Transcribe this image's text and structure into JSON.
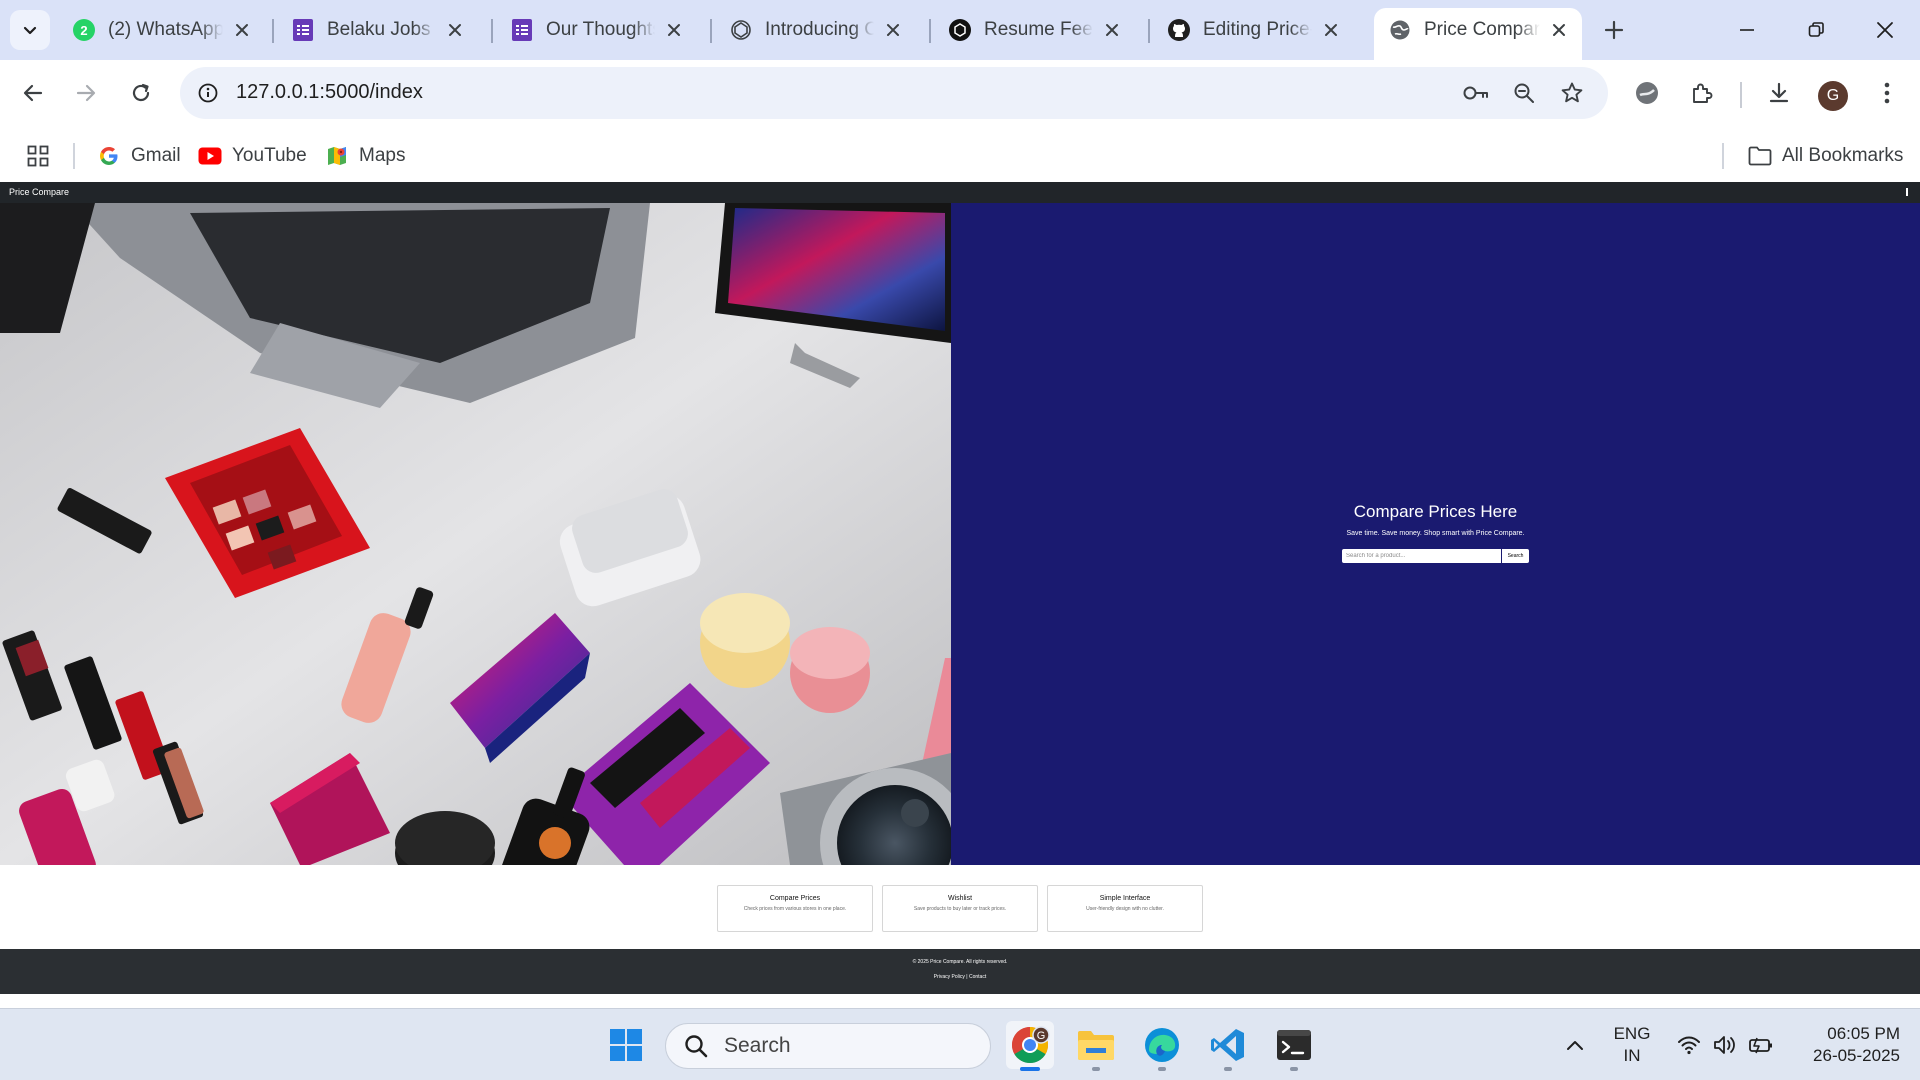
{
  "browser": {
    "tabs": [
      {
        "title": "(2) WhatsApp",
        "icon": "whatsapp-icon",
        "badge": "2",
        "active": false
      },
      {
        "title": "Belaku Jobs",
        "icon": "forms-icon",
        "active": false
      },
      {
        "title": "Our Thoughts",
        "icon": "forms-icon",
        "active": false
      },
      {
        "title": "Introducing Cl",
        "icon": "openai-icon",
        "active": false
      },
      {
        "title": "Resume Feedl",
        "icon": "openai-icon",
        "active": false
      },
      {
        "title": "Editing Price-C",
        "icon": "github-icon",
        "active": false
      },
      {
        "title": "Price Compare",
        "icon": "globe-icon",
        "active": true
      }
    ],
    "address_bar": {
      "url": "127.0.0.1:5000/index"
    },
    "profile_initial": "G",
    "bookmarks": [
      {
        "label": "Gmail",
        "icon": "google-icon"
      },
      {
        "label": "YouTube",
        "icon": "youtube-icon"
      },
      {
        "label": "Maps",
        "icon": "maps-icon"
      }
    ],
    "all_bookmarks_label": "All Bookmarks"
  },
  "site": {
    "brand": "Price Compare",
    "hero": {
      "title": "Compare Prices Here",
      "subtitle": "Save time. Save money. Shop smart with Price Compare.",
      "search_placeholder": "Search for a product...",
      "search_button": "Search"
    },
    "features": [
      {
        "title": "Compare Prices",
        "text": "Check prices from various stores in one place."
      },
      {
        "title": "Wishlist",
        "text": "Save products to buy later or track prices."
      },
      {
        "title": "Simple Interface",
        "text": "User-friendly design with no clutter."
      }
    ],
    "footer": {
      "copyright": "© 2025 Price Compare. All rights reserved.",
      "privacy_link": "Privacy Policy",
      "separator": "|",
      "contact_link": "Contact"
    }
  },
  "taskbar": {
    "search_label": "Search",
    "chrome_badge": "G",
    "language": {
      "line1": "ENG",
      "line2": "IN"
    },
    "time": "06:05 PM",
    "date": "26-05-2025",
    "apps": [
      "start-icon",
      "chrome-icon",
      "file-explorer-icon",
      "edge-icon",
      "vscode-icon",
      "terminal-icon"
    ]
  },
  "colors": {
    "tabstrip": "#dae2f8",
    "hero_background": "#1a1a70",
    "site_nav": "#212529",
    "site_footer": "#2b2f33"
  }
}
